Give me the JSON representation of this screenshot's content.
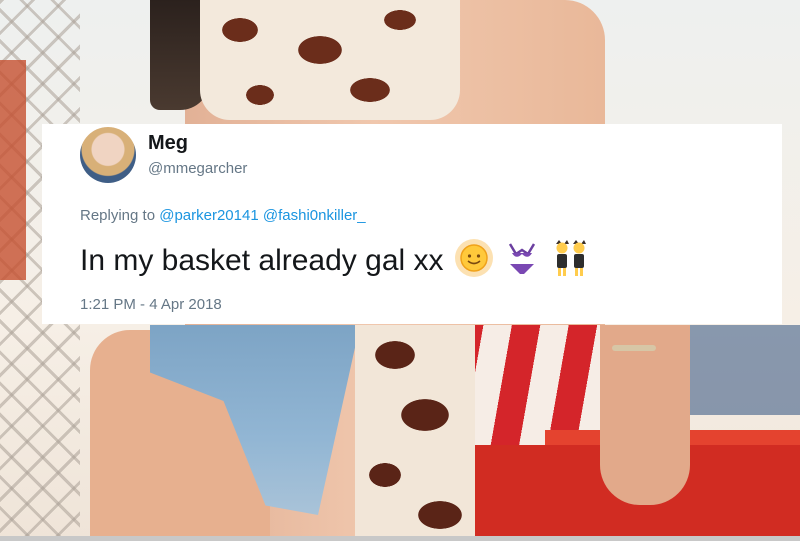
{
  "tweet": {
    "display_name": "Meg",
    "handle": "@mmegarcher",
    "replying_prefix": "Replying to",
    "mentions": [
      "@parker20141",
      "@fashi0nkiller_"
    ],
    "text": "In my basket already gal xx",
    "emojis": [
      "sun-with-face-emoji",
      "bikini-emoji",
      "dancers-emoji"
    ],
    "timestamp": "1:21 PM - 4 Apr 2018"
  },
  "colors": {
    "mention_blue": "#1b95e0",
    "secondary_text": "#657786",
    "primary_text": "#14171a",
    "card_bg": "#ffffff"
  }
}
